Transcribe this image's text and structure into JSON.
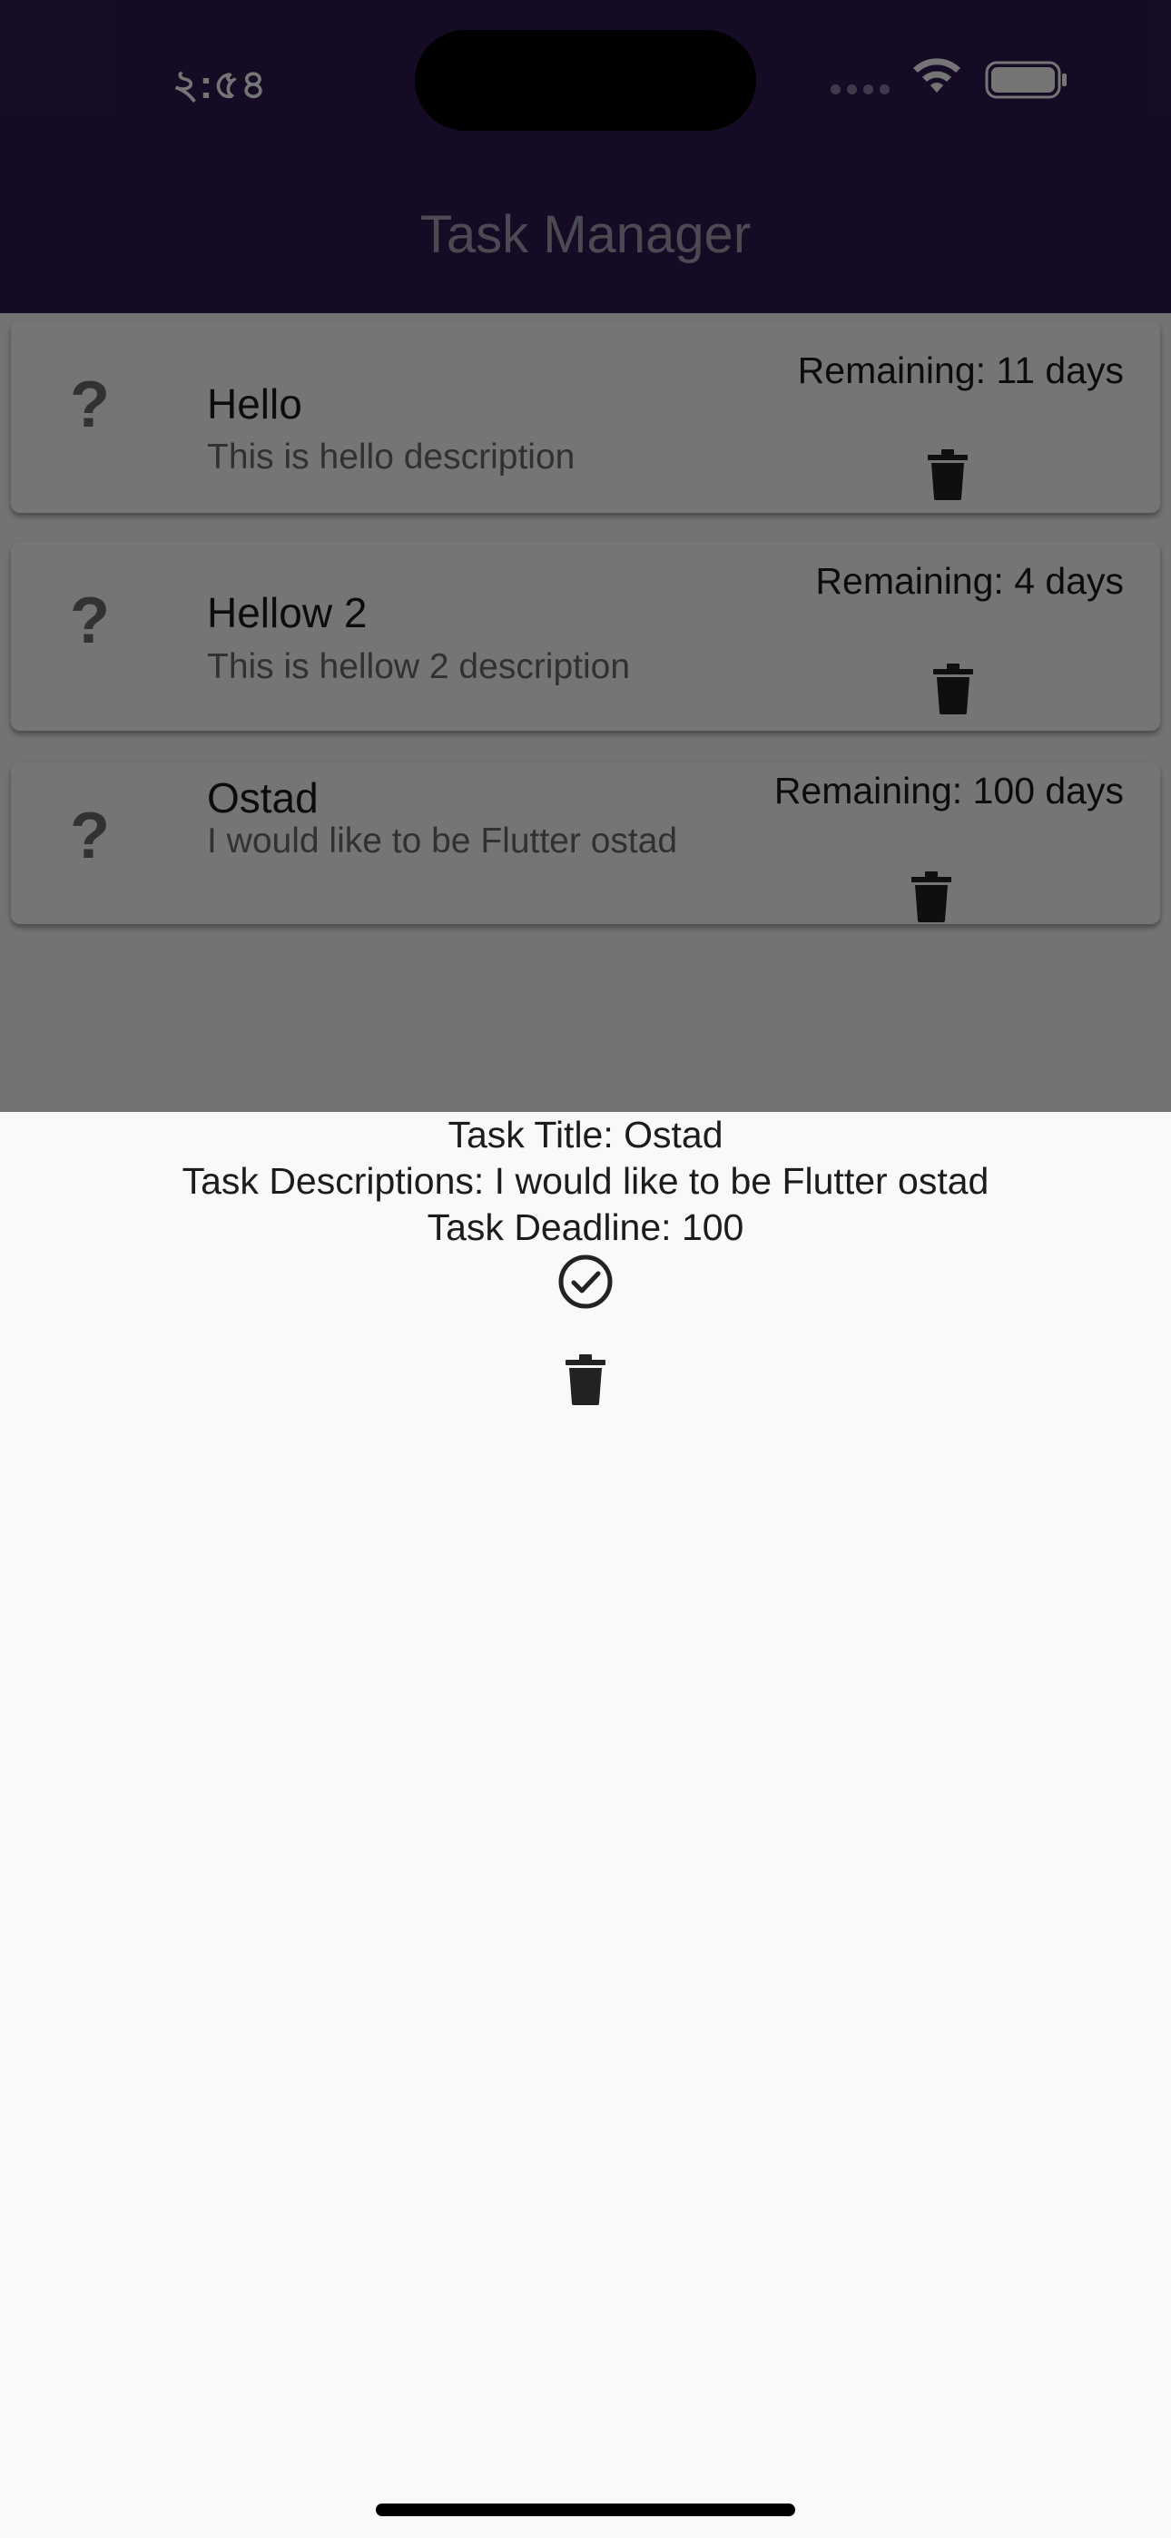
{
  "status_bar": {
    "time": "২:৫৪"
  },
  "app_bar": {
    "title": "Task Manager"
  },
  "tasks": [
    {
      "title": "Hello",
      "description": "This is hello description",
      "remaining": "Remaining: 11 days",
      "lead_icon": "?"
    },
    {
      "title": "Hellow 2",
      "description": "This is hellow 2 description",
      "remaining": "Remaining: 4 days",
      "lead_icon": "?"
    },
    {
      "title": "Ostad",
      "description": "I would like to be Flutter ostad",
      "remaining": "Remaining: 100 days",
      "lead_icon": "?"
    }
  ],
  "sheet": {
    "title_line": "Task Title: Ostad",
    "description_line": "Task Descriptions: I would like to be Flutter ostad",
    "deadline_line": "Task Deadline: 100"
  },
  "colors": {
    "app_bar": "#2e1a52",
    "scrim": "rgba(0,0,0,0.54)",
    "sheet_background": "#f9f9f9"
  }
}
